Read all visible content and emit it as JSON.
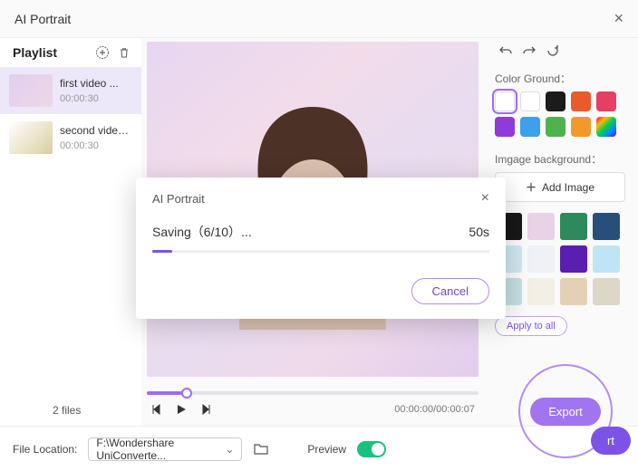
{
  "window": {
    "title": "AI Portrait"
  },
  "sidebar": {
    "label": "Playlist",
    "items": [
      {
        "name": "first video ...",
        "duration": "00:00:30"
      },
      {
        "name": "second video...",
        "duration": "00:00:30"
      }
    ],
    "file_count": "2 files"
  },
  "player": {
    "time_readout": "00:00:00/00:00:07"
  },
  "panel": {
    "color_ground_label": "Color Ground：",
    "colors": [
      "#ffffff",
      "#ffffff",
      "#1b1b1b",
      "#ea5a2d",
      "#e83e63",
      "#8e3bd9",
      "#3ea0ea",
      "#4fb24e",
      "#f19a2b",
      "rainbow"
    ],
    "image_bg_label": "Imgage background：",
    "add_image_label": "Add Image",
    "thumbs": [
      "#171717",
      "#e9d1e6",
      "#2d8a5c",
      "#26507a",
      "#cfe7f1",
      "#eff1f6",
      "#5a1eb0",
      "#bfe4f4",
      "#c4dfe1",
      "#f3efe4",
      "#e4d1b5",
      "#dcd7c6"
    ],
    "apply_all_label": "Apply to all",
    "export_label": "Export",
    "export2_label": "rt"
  },
  "footer": {
    "location_label": "File Location:",
    "location_value": "F:\\Wondershare UniConverte...",
    "preview_label": "Preview"
  },
  "modal": {
    "title": "AI Portrait",
    "status": "Saving（6/10）...",
    "eta": "50s",
    "cancel_label": "Cancel"
  }
}
